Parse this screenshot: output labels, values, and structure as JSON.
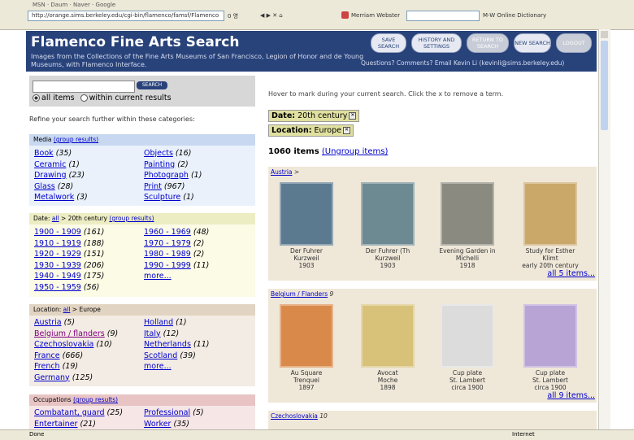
{
  "browser": {
    "address": "http://orange.sims.berkeley.edu/cgi-bin/flamenco/famsf/Flamenco",
    "go_label": "0 영",
    "search_engine": "Merriam Webster",
    "dictionary": "M-W Online Dictionary",
    "misc_tabs": [
      "MSN",
      "Daum",
      "Naver",
      "Google"
    ]
  },
  "header": {
    "title": "Flamenco Fine Arts Search",
    "subtitle": "Images from the Collections of the Fine Arts Museums of San Francisco, Legion of Honor and de Young Museums, with Flamenco Interface.",
    "questions": "Questions? Comments? Email Kevin Li (kevinli@sims.berkeley.edu)",
    "buttons": {
      "save": "SAVE SEARCH",
      "history": "HISTORY AND SETTINGS",
      "return": "RETURN TO SEARCH",
      "new": "NEW SEARCH",
      "logout": "LOGOUT"
    }
  },
  "search": {
    "button": "SEARCH",
    "placeholder": "",
    "all_items": "all items",
    "within": "within current results"
  },
  "refine_text": "Refine your search further within these categories:",
  "media": {
    "header": "Media",
    "group": "(group results)",
    "col1": [
      {
        "label": "Book",
        "count": "(35)"
      },
      {
        "label": "Ceramic",
        "count": "(1)"
      },
      {
        "label": "Drawing",
        "count": "(23)"
      },
      {
        "label": "Glass",
        "count": "(28)"
      },
      {
        "label": "Metalwork",
        "count": "(3)"
      }
    ],
    "col2": [
      {
        "label": "Objects",
        "count": "(16)"
      },
      {
        "label": "Painting",
        "count": "(2)"
      },
      {
        "label": "Photograph",
        "count": "(1)"
      },
      {
        "label": "Print",
        "count": "(967)"
      },
      {
        "label": "Sculpture",
        "count": "(1)"
      }
    ]
  },
  "date": {
    "prefix": "Date:",
    "all": "all",
    "crumb": "> 20th century",
    "group": "(group results)",
    "col1": [
      {
        "label": "1900 - 1909",
        "count": "(161)"
      },
      {
        "label": "1910 - 1919",
        "count": "(188)"
      },
      {
        "label": "1920 - 1929",
        "count": "(151)"
      },
      {
        "label": "1930 - 1939",
        "count": "(206)"
      },
      {
        "label": "1940 - 1949",
        "count": "(175)"
      },
      {
        "label": "1950 - 1959",
        "count": "(56)"
      }
    ],
    "col2": [
      {
        "label": "1960 - 1969",
        "count": "(48)"
      },
      {
        "label": "1970 - 1979",
        "count": "(2)"
      },
      {
        "label": "1980 - 1989",
        "count": "(2)"
      },
      {
        "label": "1990 - 1999",
        "count": "(11)"
      },
      {
        "label": "more...",
        "count": ""
      }
    ]
  },
  "location": {
    "prefix": "Location:",
    "all": "all",
    "crumb": "> Europe",
    "col1": [
      {
        "label": "Austria",
        "count": "(5)"
      },
      {
        "label": "Belgium / flanders",
        "count": "(9)"
      },
      {
        "label": "Czechoslovakia",
        "count": "(10)"
      },
      {
        "label": "France",
        "count": "(666)"
      },
      {
        "label": "French",
        "count": "(19)"
      },
      {
        "label": "Germany",
        "count": "(125)"
      }
    ],
    "col2": [
      {
        "label": "Holland",
        "count": "(1)"
      },
      {
        "label": "Italy",
        "count": "(12)"
      },
      {
        "label": "Netherlands",
        "count": "(11)"
      },
      {
        "label": "Scotland",
        "count": "(39)"
      },
      {
        "label": "more...",
        "count": ""
      }
    ]
  },
  "occupations": {
    "header": "Occupations",
    "group": "(group results)",
    "col1": [
      {
        "label": "Combatant, guard",
        "count": "(25)"
      },
      {
        "label": "Entertainer",
        "count": "(21)"
      }
    ],
    "col2": [
      {
        "label": "Professional",
        "count": "(5)"
      },
      {
        "label": "Worker",
        "count": "(35)"
      }
    ]
  },
  "results": {
    "hint": "Hover to mark during your current search. Click the x to remove a term.",
    "filter_date": {
      "key": "Date:",
      "value": "20th century"
    },
    "filter_location": {
      "key": "Location:",
      "value": "Europe"
    },
    "count": "1060 items",
    "ungroup": "(Ungroup items)",
    "groups": [
      {
        "name": "Austria",
        "arrow": ">",
        "more": "all 5 items...",
        "items": [
          {
            "caption": "Der Fuhrer | Kurzweil | 1903",
            "color": "#5b7a8f"
          },
          {
            "caption": "Der Fuhrer (Th | Kurzweil | 1903",
            "color": "#6d8a92"
          },
          {
            "caption": "Evening Garden in | Michelli | 1918",
            "color": "#8a8a80"
          },
          {
            "caption": "Study for Esther | Klimt | early 20th century",
            "color": "#c9a86a"
          }
        ]
      },
      {
        "name": "Belgium / Flanders",
        "arrow": "9",
        "more": "all 9 items...",
        "items": [
          {
            "caption": "Au Square | Trenquel | 1897",
            "color": "#d98a4a"
          },
          {
            "caption": "Avocat | Moche | 1898",
            "color": "#d8c27a"
          },
          {
            "caption": "Cup plate | St. Lambert | circa 1900",
            "color": "#dcdcdc"
          },
          {
            "caption": "Cup plate | St. Lambert | circa 1900",
            "color": "#b9a4d6"
          }
        ]
      },
      {
        "name": "Czechoslovakia",
        "arrow": "10"
      }
    ]
  },
  "status_text": "Done",
  "zone_text": "Internet"
}
